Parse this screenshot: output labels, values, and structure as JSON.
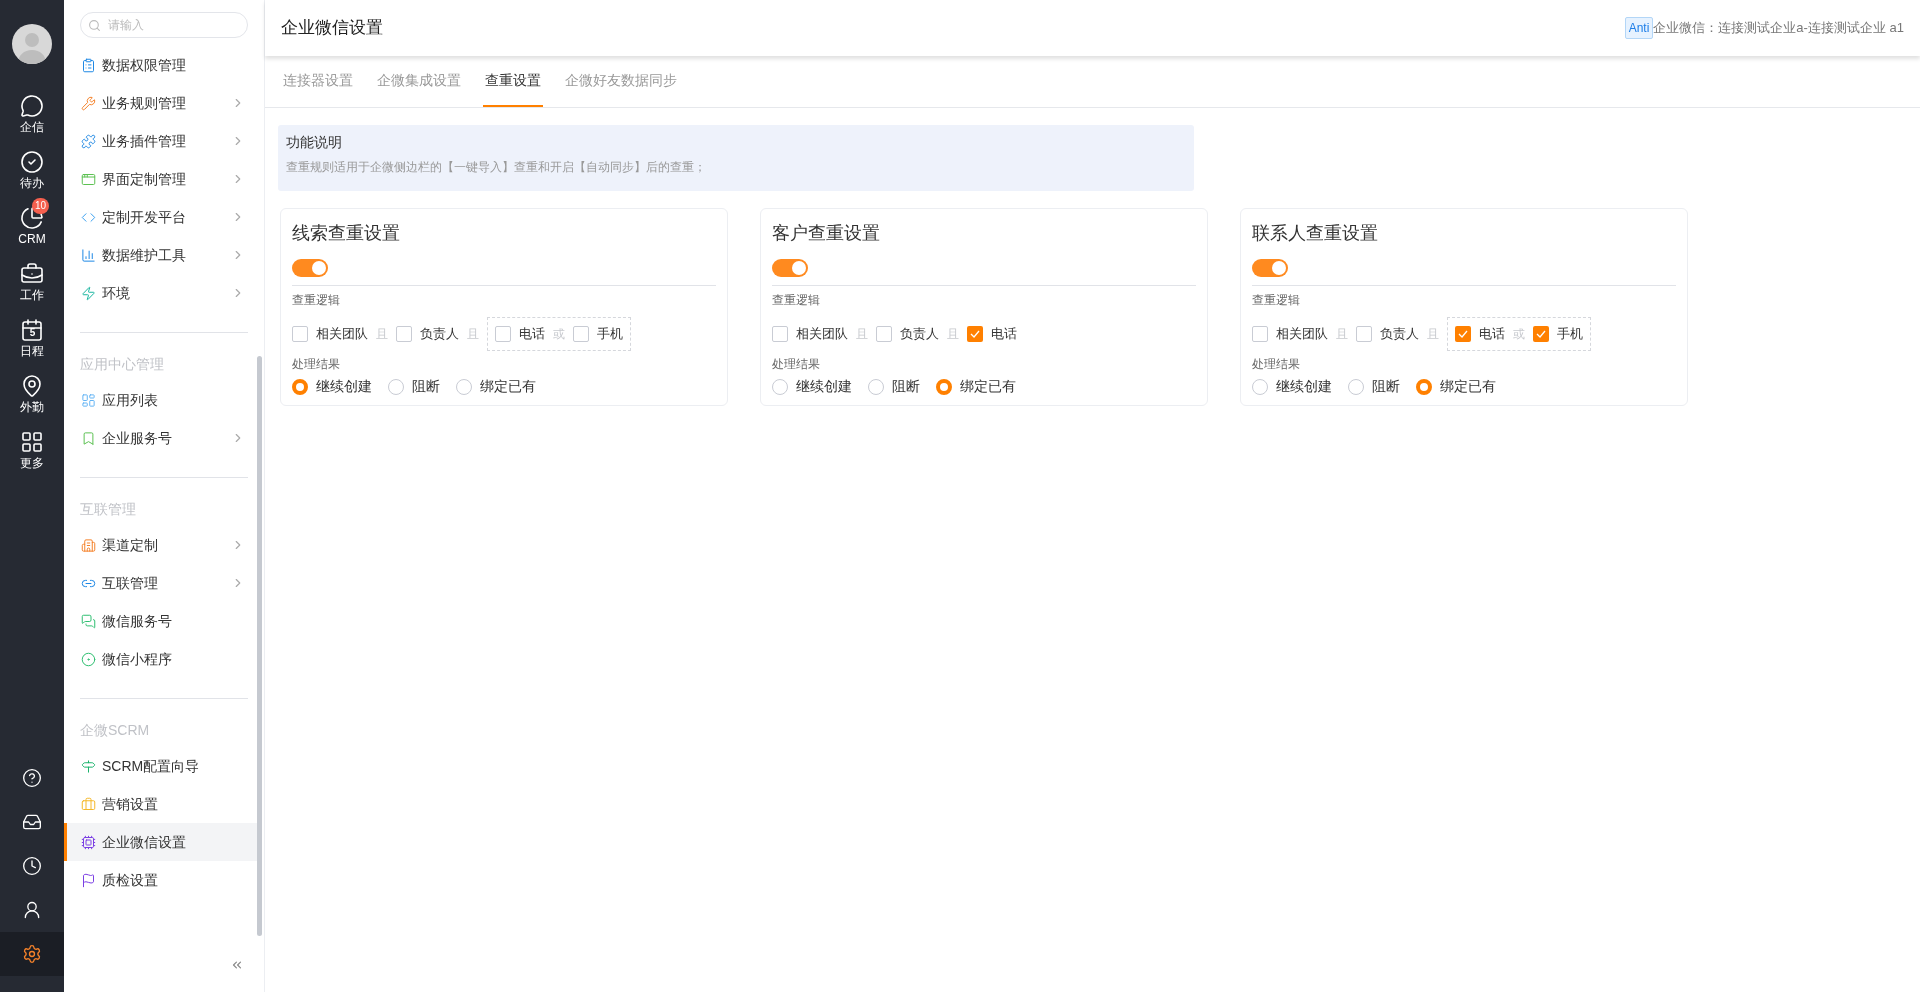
{
  "rail": {
    "items": [
      {
        "label": "企信",
        "selected": false
      },
      {
        "label": "待办",
        "selected": false
      },
      {
        "label": "CRM",
        "badge": "10",
        "selected": false
      },
      {
        "label": "工作",
        "selected": false
      },
      {
        "label": "日程",
        "calendar_day": "5",
        "selected": false
      },
      {
        "label": "外勤",
        "selected": false
      },
      {
        "label": "更多",
        "selected": false
      }
    ],
    "bottom": [
      {
        "selected": false
      },
      {
        "selected": false
      },
      {
        "selected": false
      },
      {
        "selected": false
      },
      {
        "selected": true
      }
    ]
  },
  "sidebar": {
    "search": {
      "placeholder": "请输入"
    },
    "sections": [
      {
        "items": [
          {
            "label": "数据权限管理",
            "expandable": false,
            "selected": false
          },
          {
            "label": "业务规则管理",
            "expandable": true,
            "selected": false
          },
          {
            "label": "业务插件管理",
            "expandable": true,
            "selected": false
          },
          {
            "label": "界面定制管理",
            "expandable": true,
            "selected": false
          },
          {
            "label": "定制开发平台",
            "expandable": true,
            "selected": false
          },
          {
            "label": "数据维护工具",
            "expandable": true,
            "selected": false
          },
          {
            "label": "环境",
            "expandable": true,
            "selected": false
          }
        ]
      },
      {
        "title": "应用中心管理",
        "items": [
          {
            "label": "应用列表",
            "expandable": false,
            "selected": false
          },
          {
            "label": "企业服务号",
            "expandable": true,
            "selected": false
          }
        ]
      },
      {
        "title": "互联管理",
        "items": [
          {
            "label": "渠道定制",
            "expandable": true,
            "selected": false
          },
          {
            "label": "互联管理",
            "expandable": true,
            "selected": false
          },
          {
            "label": "微信服务号",
            "expandable": false,
            "selected": false
          },
          {
            "label": "微信小程序",
            "expandable": false,
            "selected": false
          }
        ]
      },
      {
        "title": "企微SCRM",
        "items": [
          {
            "label": "SCRM配置向导",
            "expandable": false,
            "selected": false
          },
          {
            "label": "营销设置",
            "expandable": false,
            "selected": false
          },
          {
            "label": "企业微信设置",
            "expandable": false,
            "selected": true
          },
          {
            "label": "质检设置",
            "expandable": false,
            "selected": false
          }
        ]
      }
    ]
  },
  "header": {
    "title": "企业微信设置",
    "tag": "Anti",
    "account": "企业微信：连接测试企业a-连接测试企业 a1"
  },
  "tabs": [
    {
      "label": "连接器设置",
      "selected": false
    },
    {
      "label": "企微集成设置",
      "selected": false
    },
    {
      "label": "查重设置",
      "selected": true
    },
    {
      "label": "企微好友数据同步",
      "selected": false
    }
  ],
  "notice": {
    "title": "功能说明",
    "text": "查重规则适用于企微侧边栏的【一键导入】查重和开启【自动同步】后的查重；"
  },
  "cards": [
    {
      "title": "线索查重设置",
      "on": true,
      "logic_label": "查重逻辑",
      "logic": [
        {
          "kind": "checkbox",
          "label": "相关团队",
          "checked": false
        },
        {
          "kind": "connector",
          "label": "且"
        },
        {
          "kind": "checkbox",
          "label": "负责人",
          "checked": false
        },
        {
          "kind": "connector",
          "label": "且"
        },
        {
          "kind": "group",
          "children": [
            {
              "kind": "checkbox",
              "label": "电话",
              "checked": false
            },
            {
              "kind": "connector",
              "label": "或"
            },
            {
              "kind": "checkbox",
              "label": "手机",
              "checked": false
            }
          ]
        }
      ],
      "result_label": "处理结果",
      "results": [
        {
          "label": "继续创建",
          "selected": true
        },
        {
          "label": "阻断",
          "selected": false
        },
        {
          "label": "绑定已有",
          "selected": false
        }
      ]
    },
    {
      "title": "客户查重设置",
      "on": true,
      "logic_label": "查重逻辑",
      "logic": [
        {
          "kind": "checkbox",
          "label": "相关团队",
          "checked": false
        },
        {
          "kind": "connector",
          "label": "且"
        },
        {
          "kind": "checkbox",
          "label": "负责人",
          "checked": false
        },
        {
          "kind": "connector",
          "label": "且"
        },
        {
          "kind": "checkbox",
          "label": "电话",
          "checked": true
        }
      ],
      "result_label": "处理结果",
      "results": [
        {
          "label": "继续创建",
          "selected": false
        },
        {
          "label": "阻断",
          "selected": false
        },
        {
          "label": "绑定已有",
          "selected": true
        }
      ]
    },
    {
      "title": "联系人查重设置",
      "on": true,
      "logic_label": "查重逻辑",
      "logic": [
        {
          "kind": "checkbox",
          "label": "相关团队",
          "checked": false
        },
        {
          "kind": "connector",
          "label": "且"
        },
        {
          "kind": "checkbox",
          "label": "负责人",
          "checked": false
        },
        {
          "kind": "connector",
          "label": "且"
        },
        {
          "kind": "group",
          "children": [
            {
              "kind": "checkbox",
              "label": "电话",
              "checked": true
            },
            {
              "kind": "connector",
              "label": "或"
            },
            {
              "kind": "checkbox",
              "label": "手机",
              "checked": true
            }
          ]
        }
      ],
      "result_label": "处理结果",
      "results": [
        {
          "label": "继续创建",
          "selected": false
        },
        {
          "label": "阻断",
          "selected": false
        },
        {
          "label": "绑定已有",
          "selected": true
        }
      ]
    }
  ]
}
